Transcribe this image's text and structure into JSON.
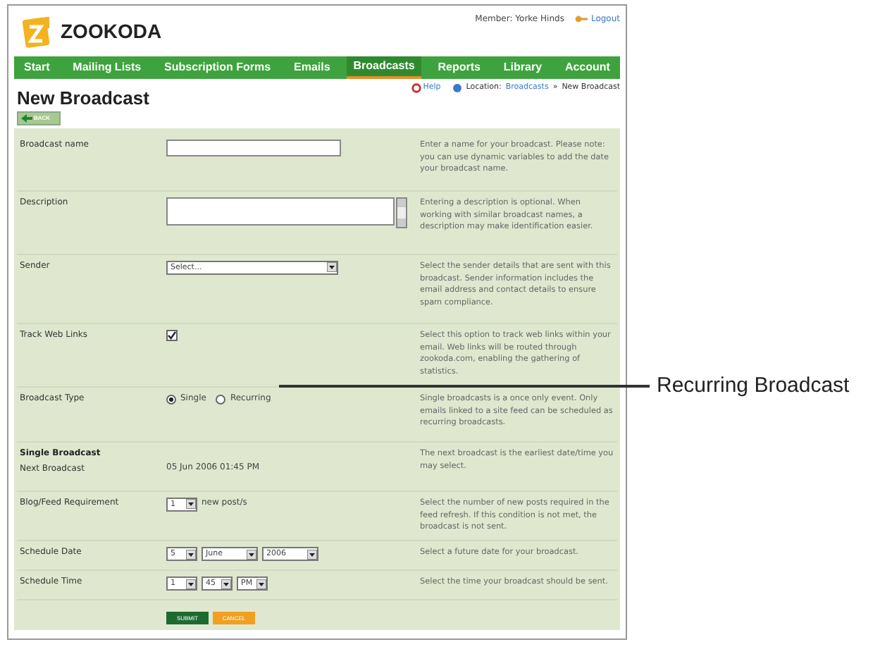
{
  "header": {
    "logo": "ZOOKODA",
    "member": "Member: Yorke Hinds",
    "logout": "Logout"
  },
  "nav": [
    {
      "label": "Start",
      "selected": false
    },
    {
      "label": "Mailing Lists",
      "selected": false
    },
    {
      "label": "Subscription Forms",
      "selected": false
    },
    {
      "label": "Emails",
      "selected": false
    },
    {
      "label": "Broadcasts",
      "selected": true
    },
    {
      "label": "Reports",
      "selected": false
    },
    {
      "label": "Library",
      "selected": false
    },
    {
      "label": "Account",
      "selected": false
    }
  ],
  "help_link": "Help",
  "location": {
    "label": "Location:",
    "crumb": "Broadcasts",
    "separator": "»",
    "current": "New Broadcast"
  },
  "title": "New Broadcast",
  "back_button": "BACK",
  "form": {
    "rows": [
      {
        "kind": "text",
        "label": "Broadcast name",
        "help": "Enter a name for your broadcast. Please note: you can use dynamic variables to add the date your broadcast name."
      },
      {
        "kind": "textarea",
        "label": "Description",
        "help": "Entering a description is optional. When working with similar broadcast names, a description may make identification easier."
      },
      {
        "kind": "select",
        "label": "Sender",
        "value": "Select...",
        "help": "Select the sender details that are sent with this broadcast. Sender information includes the email address and contact details to ensure spam compliance."
      },
      {
        "kind": "checkbox",
        "label": "Track Web Links",
        "checked": true,
        "help": "Select this option to track web links within your email. Web links will be routed through zookoda.com, enabling the gathering of statistics."
      },
      {
        "kind": "radio",
        "label": "Broadcast Type",
        "options": [
          {
            "label": "Single",
            "selected": true
          },
          {
            "label": "Recurring",
            "selected": false
          }
        ],
        "help": "Single broadcasts is a once only event. Only emails linked to a site feed can be scheduled as recurring broadcasts."
      },
      {
        "kind": "static",
        "heading": "Single Broadcast",
        "label": "Next Broadcast",
        "value": "05 Jun 2006 01:45 PM",
        "help": "The next broadcast is the earliest date/time you may select."
      },
      {
        "kind": "selects",
        "label": "Blog/Feed Requirement",
        "values": [
          "1"
        ],
        "suffix": "new post/s",
        "help": "Select the number of new posts required in the feed refresh. If this condition is not met, the broadcast is not sent."
      },
      {
        "kind": "selects",
        "label": "Schedule Date",
        "values": [
          "5",
          "June",
          "2006"
        ],
        "help": "Select a future date for your broadcast."
      },
      {
        "kind": "selects",
        "label": "Schedule Time",
        "values": [
          "1",
          "45",
          "PM"
        ],
        "help": "Select the time your broadcast should be sent."
      }
    ],
    "submit": "SUBMIT",
    "cancel": "CANCEL"
  },
  "callout": "Recurring Broadcast"
}
